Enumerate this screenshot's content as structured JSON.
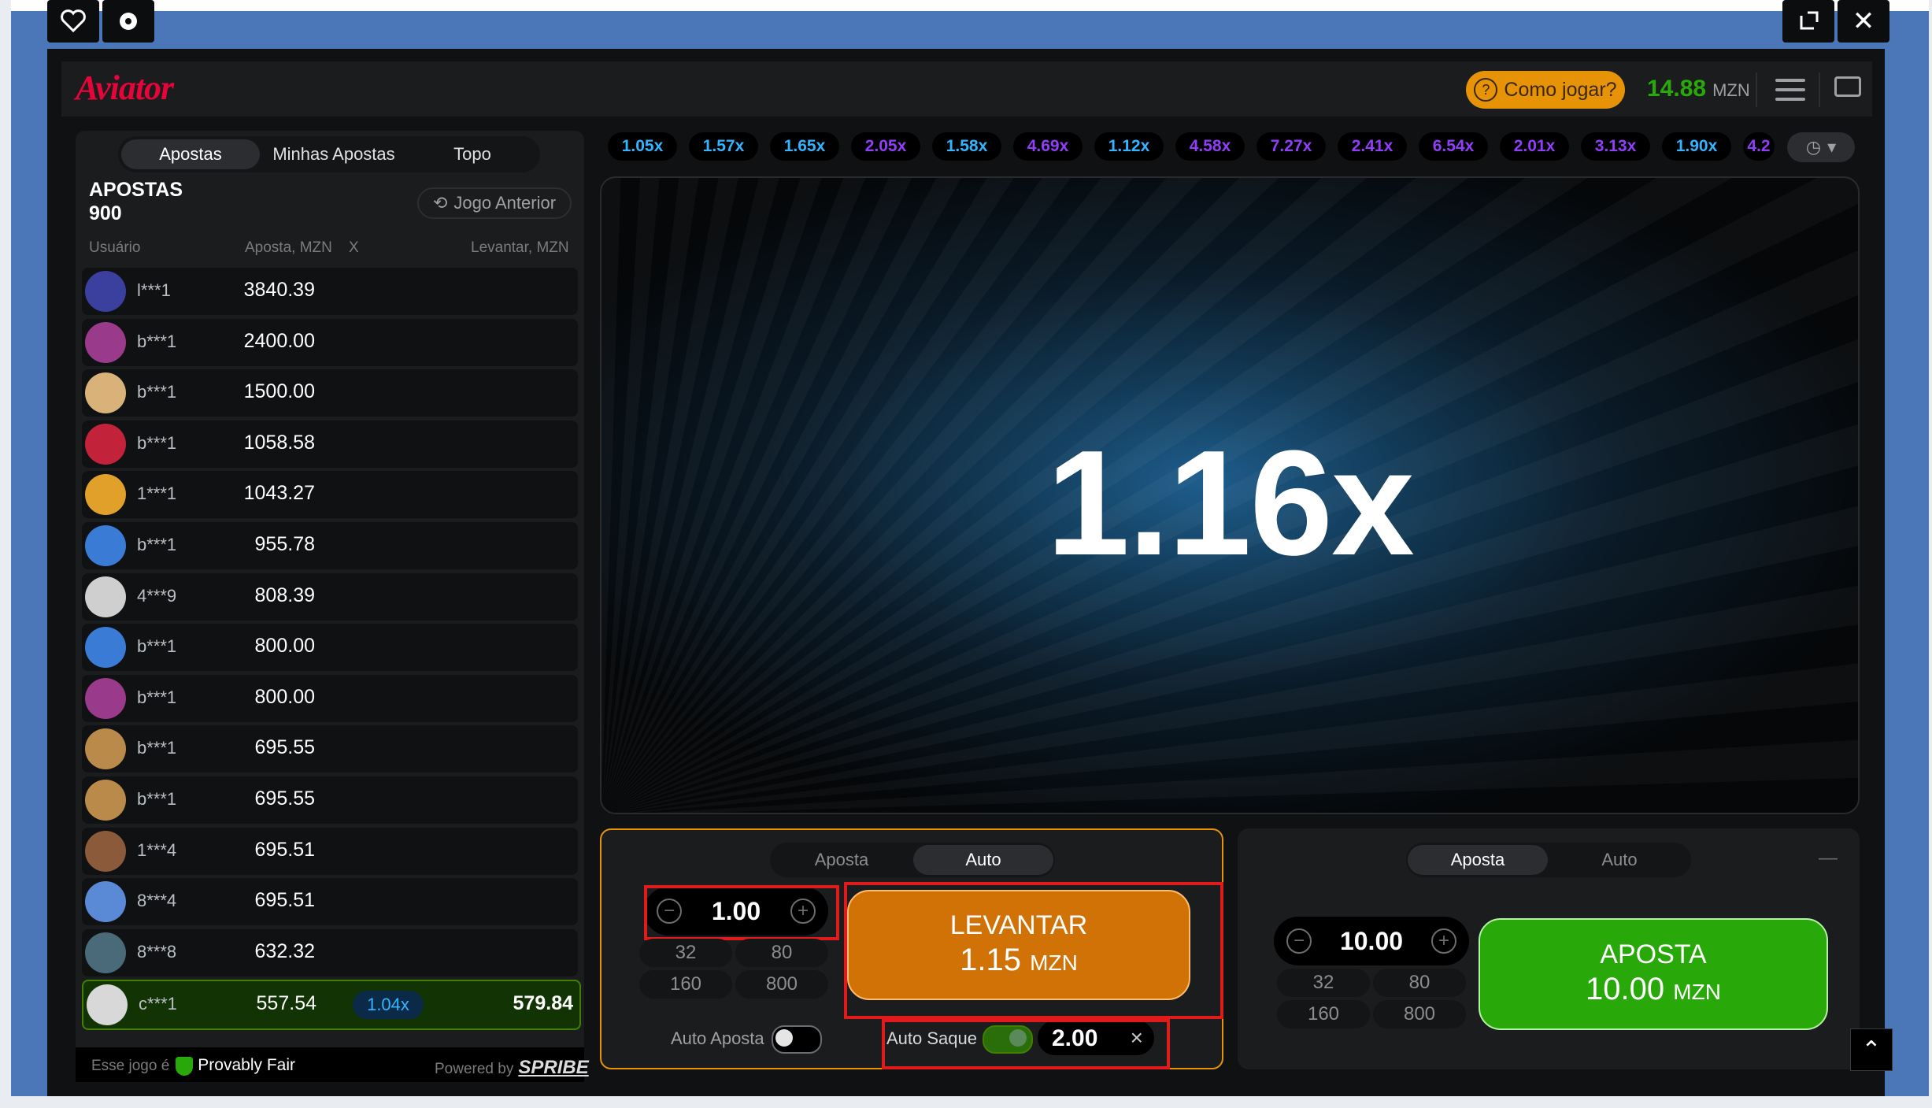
{
  "window": {
    "controls_left": [
      "heart-icon",
      "gear-icon"
    ],
    "controls_right": [
      "expand-icon",
      "close-icon"
    ],
    "close_glyph": "✕"
  },
  "header": {
    "logo": "Aviator",
    "how_to_play": "Como jogar?",
    "balance": "14.88",
    "currency": "MZN"
  },
  "left_panel": {
    "tabs": [
      "Apostas",
      "Minhas Apostas",
      "Topo"
    ],
    "active_tab": "Apostas",
    "title": "APOSTAS",
    "count": "900",
    "prev_game": "Jogo Anterior",
    "columns": {
      "user": "Usuário",
      "bet": "Aposta, MZN",
      "x": "X",
      "cashout": "Levantar, MZN"
    },
    "rows": [
      {
        "user": "l***1",
        "bet": "3840.39",
        "avatar": "#3b3f9e"
      },
      {
        "user": "b***1",
        "bet": "2400.00",
        "avatar": "#9a3a8a"
      },
      {
        "user": "b***1",
        "bet": "1500.00",
        "avatar": "#d9b27a"
      },
      {
        "user": "b***1",
        "bet": "1058.58",
        "avatar": "#c2223a"
      },
      {
        "user": "1***1",
        "bet": "1043.27",
        "avatar": "#e0a02a"
      },
      {
        "user": "b***1",
        "bet": "955.78",
        "avatar": "#3a7bd5"
      },
      {
        "user": "4***9",
        "bet": "808.39",
        "avatar": "#cfcfcf"
      },
      {
        "user": "b***1",
        "bet": "800.00",
        "avatar": "#3a7bd5"
      },
      {
        "user": "b***1",
        "bet": "800.00",
        "avatar": "#9a3a8a"
      },
      {
        "user": "b***1",
        "bet": "695.55",
        "avatar": "#b98a4a"
      },
      {
        "user": "b***1",
        "bet": "695.55",
        "avatar": "#b98a4a"
      },
      {
        "user": "1***4",
        "bet": "695.51",
        "avatar": "#8a5a3a"
      },
      {
        "user": "8***4",
        "bet": "695.51",
        "avatar": "#5a8ad5"
      },
      {
        "user": "8***8",
        "bet": "632.32",
        "avatar": "#4a6a7a"
      },
      {
        "user": "c***1",
        "bet": "557.54",
        "mult": "1.04x",
        "cashout": "579.84",
        "avatar": "#d8d8d8",
        "winner": true
      }
    ],
    "footer": {
      "fair_prefix": "Esse jogo é",
      "fair": "Provably Fair",
      "powered": "Powered by",
      "brand": "SPRIBE"
    }
  },
  "history": [
    {
      "v": "1.05x",
      "c": "#34b4ff"
    },
    {
      "v": "1.57x",
      "c": "#34b4ff"
    },
    {
      "v": "1.65x",
      "c": "#34b4ff"
    },
    {
      "v": "2.05x",
      "c": "#913ef8"
    },
    {
      "v": "1.58x",
      "c": "#34b4ff"
    },
    {
      "v": "4.69x",
      "c": "#913ef8"
    },
    {
      "v": "1.12x",
      "c": "#34b4ff"
    },
    {
      "v": "4.58x",
      "c": "#913ef8"
    },
    {
      "v": "7.27x",
      "c": "#913ef8"
    },
    {
      "v": "2.41x",
      "c": "#913ef8"
    },
    {
      "v": "6.54x",
      "c": "#913ef8"
    },
    {
      "v": "2.01x",
      "c": "#913ef8"
    },
    {
      "v": "3.13x",
      "c": "#913ef8"
    },
    {
      "v": "1.90x",
      "c": "#34b4ff"
    },
    {
      "v": "4.2",
      "c": "#913ef8"
    }
  ],
  "game": {
    "multiplier": "1.16x"
  },
  "bet1": {
    "tabs": [
      "Aposta",
      "Auto"
    ],
    "active_tab": "Auto",
    "amount": "1.00",
    "quick": [
      "32",
      "80",
      "160",
      "800"
    ],
    "button_line1": "LEVANTAR",
    "button_amount": "1.15",
    "button_currency": "MZN",
    "auto_bet_label": "Auto Aposta",
    "auto_cashout_label": "Auto Saque",
    "auto_cashout_value": "2.00",
    "clear": "×"
  },
  "bet2": {
    "tabs": [
      "Aposta",
      "Auto"
    ],
    "active_tab": "Aposta",
    "amount": "10.00",
    "quick": [
      "32",
      "80",
      "160",
      "800"
    ],
    "button_line1": "APOSTA",
    "button_amount": "10.00",
    "button_currency": "MZN",
    "collapse": "—"
  },
  "colors": {
    "brand_red": "#e50539",
    "green": "#28a909",
    "orange": "#d07206",
    "win_row": "#123405"
  }
}
